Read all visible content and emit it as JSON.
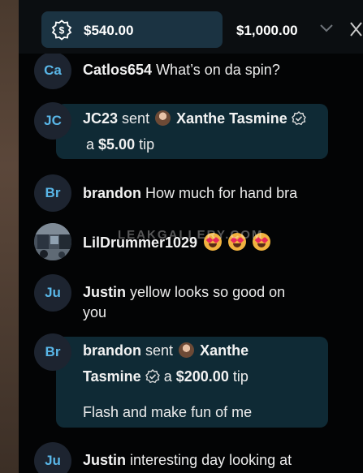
{
  "goal": {
    "current": "$540.00",
    "target": "$1,000.00",
    "icon": "dollar-goal-icon"
  },
  "messages": [
    {
      "avatar": "Ca",
      "user": "Catlos654",
      "text": "What’s on da spin?"
    },
    {
      "avatar": "JC",
      "user": "JC23",
      "sent": "sent",
      "recipient": "Xanthe Tasmine",
      "prefix": "a",
      "amount": "$5.00",
      "suffix": "tip"
    },
    {
      "avatar": "Br",
      "user": "brandon",
      "text": "How much for hand bra"
    },
    {
      "user": "LilDrummer1029"
    },
    {
      "avatar": "Ju",
      "user": "Justin",
      "text": "yellow looks so good on",
      "text2": "you"
    },
    {
      "avatar": "Br",
      "user": "brandon",
      "sent": "sent",
      "recipient_first": "Xanthe",
      "recipient_last": "Tasmine",
      "prefix": "a",
      "amount": "$200.00",
      "suffix": "tip",
      "note": "Flash and make fun of me"
    },
    {
      "avatar": "Ju",
      "user": "Justin",
      "text": "interesting day looking at"
    }
  ],
  "watermark": "LEAKGALLERY.COM",
  "colors": {
    "bubble": "#0f2a35",
    "accent": "#59b6e7",
    "goal_chip": "#1b3342"
  }
}
